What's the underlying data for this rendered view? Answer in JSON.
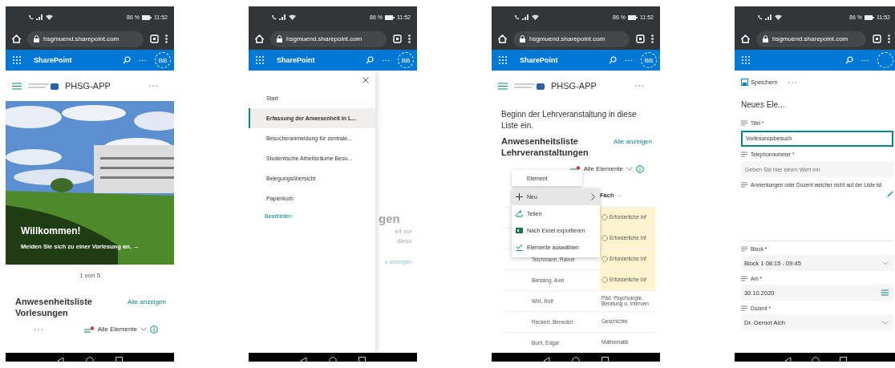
{
  "phones": [
    {
      "kind": "home",
      "status_bar": {
        "battery": "86 %",
        "time": "11:52"
      },
      "address_bar": {
        "url": "hsgmuend.sharepoint.com"
      },
      "suite_bar": {
        "title": "SharePoint",
        "avatar": "BB"
      },
      "site_header": {
        "title": "PHSG-APP"
      },
      "hero": {
        "kind": "picture",
        "heading": "Willkommen!",
        "text": "Melden Sie sich zu einer Vorlesung an. →"
      },
      "pager": "1 von 5",
      "list_section": {
        "title": "Anwesenheitsliste Vorlesungen",
        "link": "Alle anzeigen",
        "view": "Alle Elemente"
      }
    },
    {
      "kind": "navigation",
      "status_bar": {
        "battery": "86 %",
        "time": "11:52"
      },
      "address_bar": {
        "url": "hsgmuend.sharepoint.com"
      },
      "suite_bar": {
        "title": "SharePoint",
        "avatar": "BB"
      },
      "nav_panel": {
        "items": [
          {
            "label": "Start",
            "selected": false
          },
          {
            "label": "Erfassung der Anwesenheit in L...",
            "selected": true
          },
          {
            "label": "Besucheranmeldung für zentrale...",
            "selected": false
          },
          {
            "label": "Studentische Arbeitsräume Besu...",
            "selected": false
          },
          {
            "label": "Belegungsübersicht",
            "selected": false
          },
          {
            "label": "Papierkorb",
            "selected": false
          }
        ],
        "edit_link": "Bearbeiten"
      },
      "background_fragments": {
        "heading": "gen",
        "lines": [
          "eit vor",
          "diese"
        ],
        "link": "e anzeigen"
      }
    },
    {
      "kind": "list",
      "status_bar": {
        "battery": "86 %",
        "time": "11:52"
      },
      "address_bar": {
        "url": "hsgmuend.sharepoint.com"
      },
      "suite_bar": {
        "title": "SharePoint",
        "avatar": "BB"
      },
      "site_header": {
        "title": "PHSG-APP"
      },
      "intro": "Beginn der Lehrveranstaltung in diese Liste ein.",
      "list_section": {
        "title": "Anwesenheitsliste Lehrveranstaltungen",
        "link": "Alle anzeigen",
        "view": "Alle Elemente"
      },
      "table": {
        "column": "Fach",
        "rows": [
          {
            "fach": "Erforderliche Inf",
            "missing_info": true
          },
          {
            "fach": "Erforderliche Inf",
            "missing_info": true
          },
          {
            "name": "Teichmann, Rainer",
            "fach": "Erforderliche Inf",
            "missing_info": true
          },
          {
            "name": "Blessing, Axel",
            "fach": "Erforderliche Inf",
            "missing_info": true
          },
          {
            "name": "Wirt, Rolf",
            "fach": "Päd. Psychologie, Beratung u. Interven",
            "missing_info": false
          },
          {
            "name": "Reckert, Benedict",
            "fach": "Geschichte",
            "missing_info": false
          },
          {
            "name": "Bunt, Edgar",
            "fach": "Mathematik",
            "missing_info": false
          }
        ]
      },
      "submenu": {
        "label": "Element"
      },
      "menu": [
        {
          "kind": "new",
          "label": "Neu",
          "selected": true
        },
        {
          "kind": "share",
          "label": "Teilen",
          "selected": false
        },
        {
          "kind": "excel",
          "label": "Nach Excel exportieren",
          "selected": false
        },
        {
          "kind": "select",
          "label": "Elemente auswählen",
          "selected": false
        }
      ]
    },
    {
      "kind": "form",
      "status_bar": {
        "battery": "86 %",
        "time": "11:52"
      },
      "address_bar": {
        "url": "hsgmuend.sharepoint.com"
      },
      "command_bar": {
        "save": "Speichern"
      },
      "title": "Neues Ele...",
      "fields": [
        {
          "kind": "text",
          "label": "Titel *",
          "value": "Vorlesungsbesuch",
          "focused": true
        },
        {
          "kind": "text",
          "label": "Telephonnummer *",
          "placeholder": "Geben Sie hier einen Wert ein",
          "focused": false
        },
        {
          "kind": "multiline",
          "label": "Anmerkungen oder Dozent welcher nicht auf der Liste ist"
        },
        {
          "kind": "choice",
          "label": "Block *",
          "value": "Block 1 08:15 - 09:45"
        },
        {
          "kind": "date",
          "label": "Am *",
          "value": "30.10.2020"
        },
        {
          "kind": "person",
          "label": "Dozent *",
          "value": "Dr. Gernot Aich"
        }
      ]
    }
  ]
}
